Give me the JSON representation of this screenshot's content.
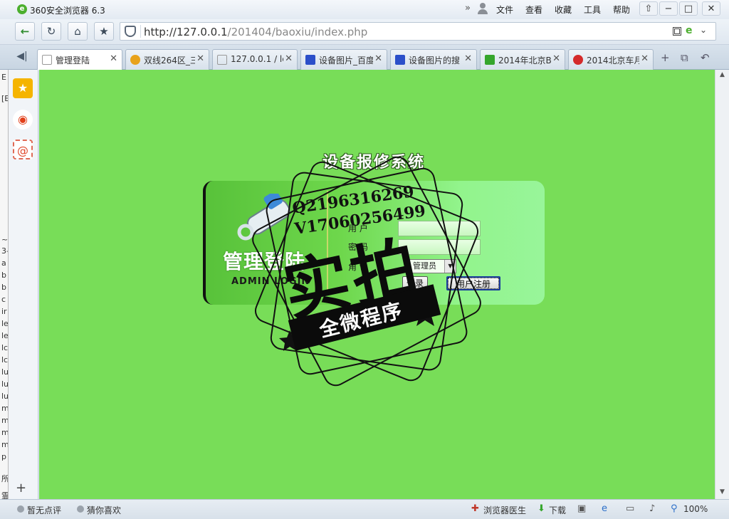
{
  "window": {
    "title": "360安全浏览器 6.3",
    "menu": [
      "文件",
      "查看",
      "收藏",
      "工具",
      "帮助"
    ],
    "controls": {
      "pin": "⇧",
      "minimize": "−",
      "maximize": "□",
      "close": "✕"
    }
  },
  "address_bar": {
    "url_host": "http://127.0.0.1",
    "url_path": "/201404/baoxiu/index.php"
  },
  "tabs": [
    {
      "label": "管理登陆",
      "active": true,
      "favicon_color": "#ffffff"
    },
    {
      "label": "双线264区_三",
      "active": false,
      "favicon_color": "#e8a21b"
    },
    {
      "label": "127.0.0.1 / lc",
      "active": false,
      "favicon_color": "#ffffff"
    },
    {
      "label": "设备图片_百度",
      "active": false,
      "favicon_color": "#2b4fc9"
    },
    {
      "label": "设备图片的搜",
      "active": false,
      "favicon_color": "#2b4fc9"
    },
    {
      "label": "2014年北京B",
      "active": false,
      "favicon_color": "#35a62c"
    },
    {
      "label": "2014北京车月",
      "active": false,
      "favicon_color": "#d42a2a"
    }
  ],
  "sidebar": {
    "icons": [
      "favorites-star-icon",
      "weibo-icon",
      "mail-icon"
    ],
    "add": "+"
  },
  "background_window_chars": [
    "E",
    "[E",
    "~",
    "3-",
    "a",
    "b",
    "b",
    "c",
    "ir",
    "le",
    "le",
    "lc",
    "lc",
    "lu",
    "lu",
    "lu",
    "m",
    "m",
    "m",
    "m",
    "p",
    "所",
    "霊"
  ],
  "page": {
    "heading": "设备报修系统",
    "panel": {
      "title_cn": "管理登陆",
      "title_en": "ADMIN LOGIN",
      "user_label": "用  户",
      "password_label": "密  码",
      "role_label": "角  色",
      "user_value": "",
      "password_value": "",
      "role_selected": "管理员",
      "login_button": "登录",
      "register_button": "用户注册"
    }
  },
  "watermark": {
    "line_q": "Q2196316269",
    "line_v": "V17060256499",
    "big_text": "实拍",
    "banner_text": "全微程序"
  },
  "status_bar": {
    "comment": "暂无点评",
    "guess": "猜你喜欢",
    "doctor": "浏览器医生",
    "download": "下载",
    "zoom": "100%"
  },
  "colors": {
    "page_bg": "#78dd58",
    "panel_left": "#58c23a",
    "panel_right": "#98f59a"
  }
}
